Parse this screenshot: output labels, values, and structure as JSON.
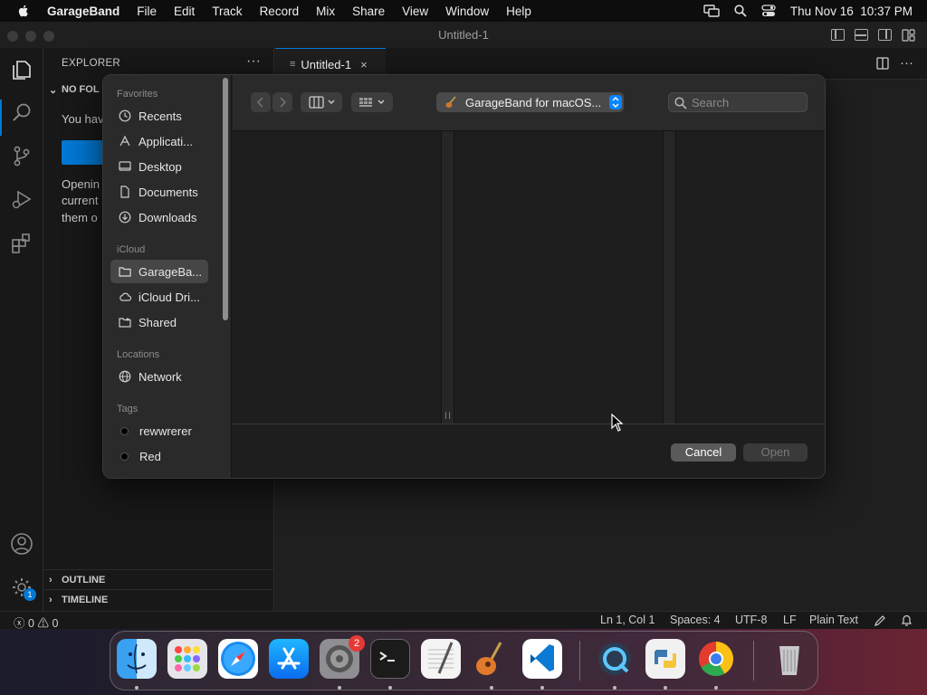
{
  "menubar": {
    "app": "GarageBand",
    "items": [
      "File",
      "Edit",
      "Track",
      "Record",
      "Mix",
      "Share",
      "View",
      "Window",
      "Help"
    ],
    "clock": "Thu Nov 16  10:37 PM"
  },
  "window": {
    "title": "Untitled-1"
  },
  "sidebar": {
    "header": "EXPLORER",
    "more": "···",
    "section": "NO FOL",
    "line1": "You hav",
    "line2": "Openin",
    "line3": "current",
    "line4": "them o",
    "outline": "OUTLINE",
    "timeline": "TIMELINE"
  },
  "tab": {
    "label": "Untitled-1",
    "close": "×"
  },
  "status": {
    "errors": "0",
    "warnings": "0",
    "position": "Ln 1, Col 1",
    "spaces": "Spaces: 4",
    "encoding": "UTF-8",
    "eol": "LF",
    "language": "Plain Text"
  },
  "accounts_badge": "1",
  "dialog": {
    "favorites_label": "Favorites",
    "favorites": [
      "Recents",
      "Applicati...",
      "Desktop",
      "Documents",
      "Downloads"
    ],
    "icloud_label": "iCloud",
    "icloud": [
      "GarageBa...",
      "iCloud Dri...",
      "Shared"
    ],
    "locations_label": "Locations",
    "locations": [
      "Network"
    ],
    "tags_label": "Tags",
    "tags": [
      "rewwrerer",
      "Red"
    ],
    "path": "GarageBand for macOS...",
    "search_placeholder": "Search",
    "cancel": "Cancel",
    "open": "Open"
  },
  "dock": {
    "settings_badge": "2",
    "apps": [
      "finder-icon",
      "launchpad-icon",
      "safari-icon",
      "app-store-icon",
      "system-settings-icon",
      "terminal-icon",
      "textedit-icon",
      "garageband-icon",
      "vscode-icon",
      "quicktime-icon",
      "python-launcher-icon",
      "chrome-icon",
      "trash-icon"
    ]
  },
  "colors": {
    "accent": "#0078d4",
    "dialog_stepper": "#0a84ff",
    "badge": "#e53935"
  }
}
